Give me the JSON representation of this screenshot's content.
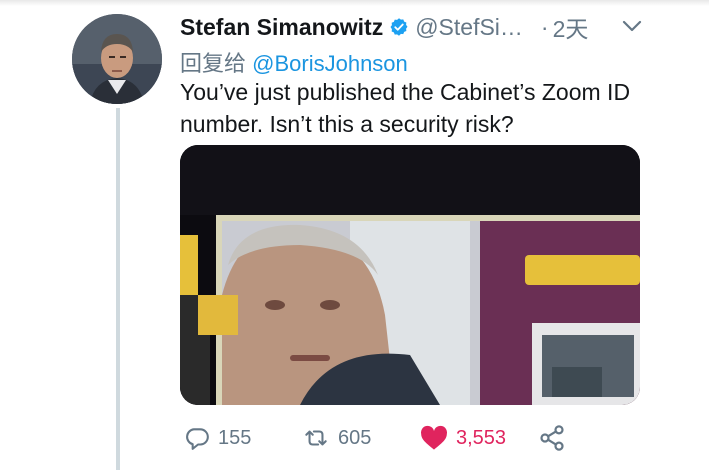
{
  "tweet": {
    "display_name": "Stefan Simanowitz",
    "handle": "@StefSi…",
    "dot": "·",
    "time": "2天",
    "reply_prefix": "回复给",
    "reply_mention": "@BorisJohnson",
    "text": "You’ve just published the Cabinet’s Zoom ID number. Isn’t this a security risk?"
  },
  "actions": {
    "reply_count": "155",
    "retweet_count": "605",
    "like_count": "3,553"
  },
  "colors": {
    "name": "#14171a",
    "muted": "#657786",
    "link": "#1b95e0",
    "verified": "#1da1f2",
    "like": "#e0245e",
    "thread_line": "#cfd9de"
  },
  "icons": {
    "verified": "verified-badge-icon",
    "caret": "chevron-down-icon",
    "reply": "reply-icon",
    "retweet": "retweet-icon",
    "like": "heart-icon",
    "share": "share-icon"
  }
}
